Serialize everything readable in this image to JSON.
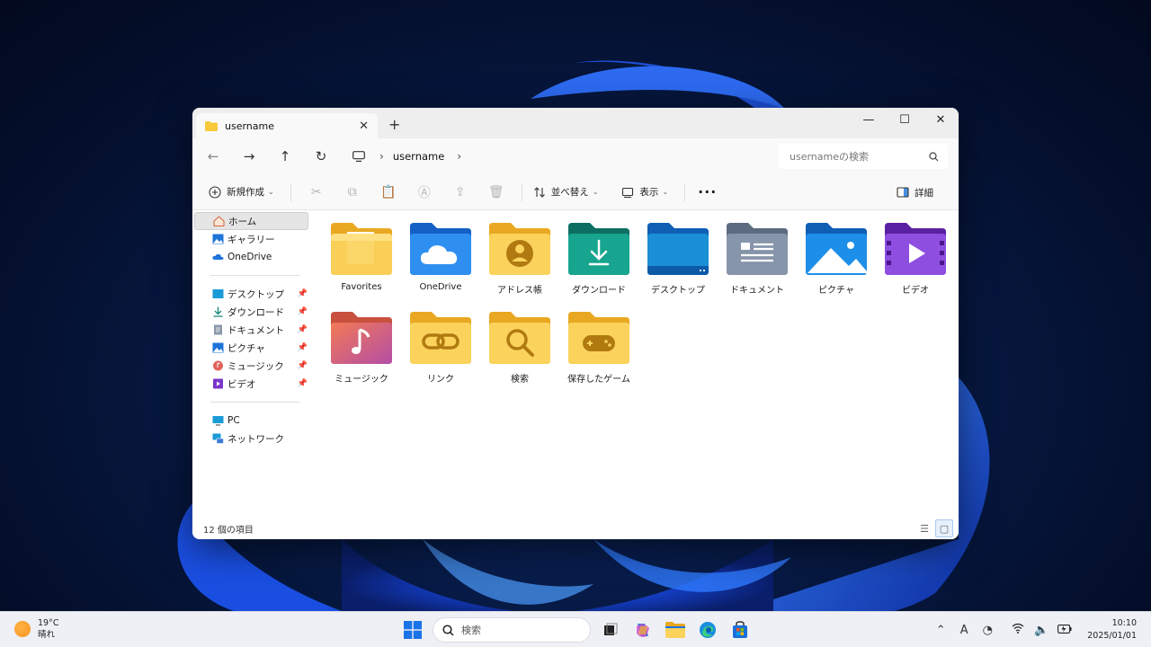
{
  "window": {
    "tab_title": "username",
    "new_tab": "+",
    "tab_close": "✕",
    "controls": {
      "minimize": "—",
      "maximize": "☐",
      "close": "✕"
    }
  },
  "address": {
    "back": "←",
    "forward": "→",
    "up": "↑",
    "refresh": "↻",
    "crumb": "username",
    "crumb_sep": "›",
    "search_placeholder": "usernameの検索"
  },
  "commands": {
    "new": "新規作成",
    "sort": "並べ替え",
    "view": "表示",
    "more": "···",
    "details": "詳細"
  },
  "sidebar": {
    "home": "ホーム",
    "gallery": "ギャラリー",
    "onedrive": "OneDrive",
    "quick": [
      {
        "label": "デスクトップ"
      },
      {
        "label": "ダウンロード"
      },
      {
        "label": "ドキュメント"
      },
      {
        "label": "ピクチャ"
      },
      {
        "label": "ミュージック"
      },
      {
        "label": "ビデオ"
      }
    ],
    "pc": "PC",
    "network": "ネットワーク"
  },
  "items": [
    {
      "label": "Favorites",
      "icon": "favorites-folder-icon"
    },
    {
      "label": "OneDrive",
      "icon": "onedrive-folder-icon"
    },
    {
      "label": "アドレス帳",
      "icon": "contacts-folder-icon"
    },
    {
      "label": "ダウンロード",
      "icon": "downloads-folder-icon"
    },
    {
      "label": "デスクトップ",
      "icon": "desktop-folder-icon"
    },
    {
      "label": "ドキュメント",
      "icon": "documents-folder-icon"
    },
    {
      "label": "ピクチャ",
      "icon": "pictures-folder-icon"
    },
    {
      "label": "ビデオ",
      "icon": "videos-folder-icon"
    },
    {
      "label": "ミュージック",
      "icon": "music-folder-icon"
    },
    {
      "label": "リンク",
      "icon": "links-folder-icon"
    },
    {
      "label": "検索",
      "icon": "searches-folder-icon"
    },
    {
      "label": "保存したゲーム",
      "icon": "saved-games-folder-icon"
    }
  ],
  "status": {
    "count": "12 個の項目"
  },
  "taskbar": {
    "temp": "19°C",
    "weather": "晴れ",
    "search": "検索",
    "time": "10:10",
    "date": "2025/01/01",
    "ime": "A"
  },
  "colors": {
    "folder_yellow": "#f8c93a",
    "onedrive_blue": "#1e74d8",
    "download_green": "#13897a",
    "video_purple": "#7a35c9"
  }
}
